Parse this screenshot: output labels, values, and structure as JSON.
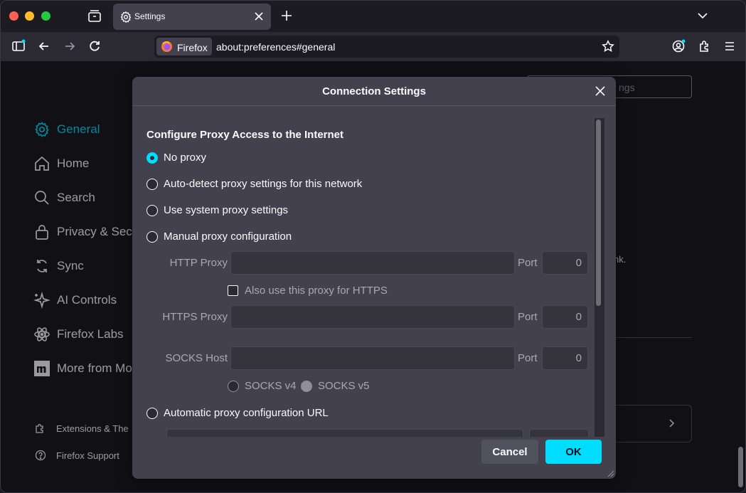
{
  "browser": {
    "tab": {
      "title": "Settings"
    },
    "identity_label": "Firefox",
    "url": "about:preferences#general"
  },
  "settings_page": {
    "nav": [
      {
        "label": "General",
        "icon": "gear-icon",
        "active": true
      },
      {
        "label": "Home",
        "icon": "home-icon"
      },
      {
        "label": "Search",
        "icon": "search-icon"
      },
      {
        "label": "Privacy & Secu",
        "icon": "lock-icon"
      },
      {
        "label": "Sync",
        "icon": "sync-icon"
      },
      {
        "label": "AI Controls",
        "icon": "sparkle-icon"
      },
      {
        "label": "Firefox Labs",
        "icon": "atom-icon"
      },
      {
        "label": "More from Moz",
        "icon": "mozilla-icon"
      }
    ],
    "footer": [
      {
        "label": "Extensions & The",
        "icon": "puzzle-icon"
      },
      {
        "label": "Firefox Support",
        "icon": "help-icon"
      }
    ],
    "find_placeholder_fragment": "ngs",
    "body_fragment": "nk."
  },
  "dialog": {
    "title": "Connection Settings",
    "section_title": "Configure Proxy Access to the Internet",
    "options": {
      "no_proxy": "No proxy",
      "auto_detect": "Auto-detect proxy settings for this network",
      "system": "Use system proxy settings",
      "manual": "Manual proxy configuration",
      "auto_url": "Automatic proxy configuration URL"
    },
    "selected": "no_proxy",
    "manual": {
      "http_label": "HTTP Proxy",
      "http_value": "",
      "http_port_label": "Port",
      "http_port": "0",
      "also_https": "Also use this proxy for HTTPS",
      "https_label": "HTTPS Proxy",
      "https_value": "",
      "https_port_label": "Port",
      "https_port": "0",
      "socks_label": "SOCKS Host",
      "socks_value": "",
      "socks_port_label": "Port",
      "socks_port": "0",
      "socks_v4": "SOCKS v4",
      "socks_v5": "SOCKS v5"
    },
    "buttons": {
      "cancel": "Cancel",
      "ok": "OK"
    }
  },
  "colors": {
    "accent": "#00ddff",
    "dialog_bg": "#42414d",
    "page_bg": "#1c1b22",
    "toolbar_bg": "#2b2a33"
  }
}
